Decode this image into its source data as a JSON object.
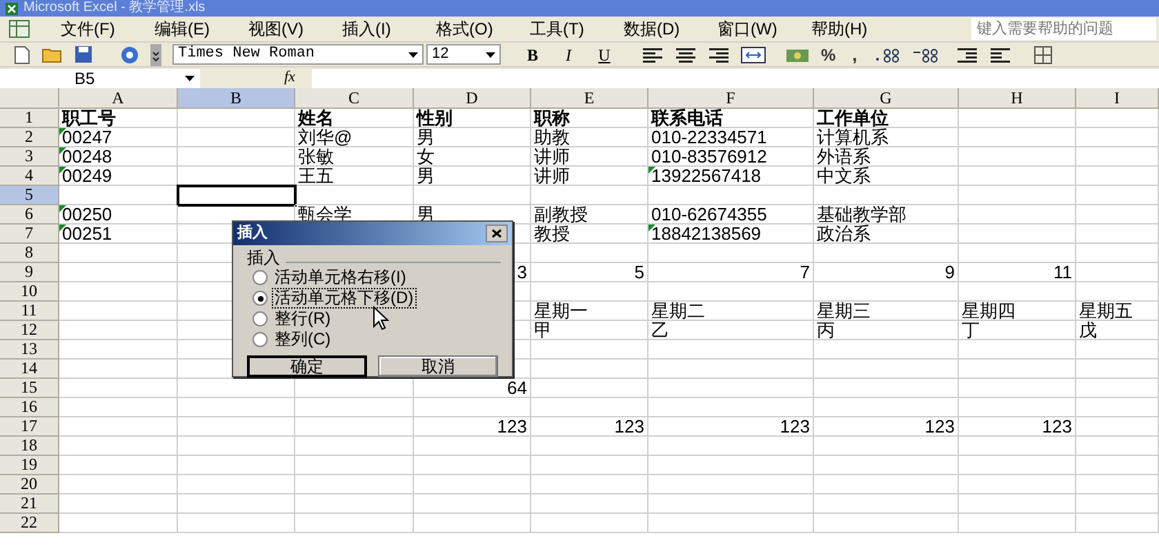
{
  "window": {
    "title": "Microsoft Excel - 教学管理.xls"
  },
  "menu": [
    "文件(F)",
    "编辑(E)",
    "视图(V)",
    "插入(I)",
    "格式(O)",
    "工具(T)",
    "数据(D)",
    "窗口(W)",
    "帮助(H)"
  ],
  "help_box": {
    "placeholder": "键入需要帮助的问题"
  },
  "toolbar": {
    "font": "Times New Roman",
    "size": "12",
    "bold": "B",
    "italic": "I",
    "underline": "U",
    "percent": "%",
    "comma": ","
  },
  "formula_bar": {
    "name_box": "B5",
    "fx": "fx"
  },
  "columns": [
    {
      "label": "A",
      "selected": false
    },
    {
      "label": "B",
      "selected": true
    },
    {
      "label": "C",
      "selected": false
    },
    {
      "label": "D",
      "selected": false
    },
    {
      "label": "E",
      "selected": false
    },
    {
      "label": "F",
      "selected": false
    },
    {
      "label": "G",
      "selected": false
    },
    {
      "label": "H",
      "selected": false
    },
    {
      "label": "I",
      "selected": false
    }
  ],
  "rows": [
    {
      "label": "1",
      "selected": false,
      "cells": [
        {
          "text": "职工号",
          "kind": "heading",
          "flag": false
        },
        null,
        {
          "text": "姓名",
          "kind": "heading",
          "flag": false
        },
        {
          "text": "性别",
          "kind": "heading",
          "flag": false
        },
        {
          "text": "职称",
          "kind": "heading",
          "flag": false
        },
        {
          "text": "联系电话",
          "kind": "heading",
          "flag": false
        },
        {
          "text": "工作单位",
          "kind": "heading",
          "flag": false
        },
        null,
        null
      ]
    },
    {
      "label": "2",
      "selected": false,
      "cells": [
        {
          "text": "00247",
          "kind": "text",
          "flag": true
        },
        null,
        {
          "text": "刘华@",
          "kind": "text",
          "flag": false
        },
        {
          "text": "男",
          "kind": "text",
          "flag": false
        },
        {
          "text": "助教",
          "kind": "text",
          "flag": false
        },
        {
          "text": "010-22334571",
          "kind": "text",
          "flag": false
        },
        {
          "text": "计算机系",
          "kind": "text",
          "flag": false
        },
        null,
        null
      ]
    },
    {
      "label": "3",
      "selected": false,
      "cells": [
        {
          "text": "00248",
          "kind": "text",
          "flag": true
        },
        null,
        {
          "text": "张敏",
          "kind": "text",
          "flag": false
        },
        {
          "text": "女",
          "kind": "text",
          "flag": false
        },
        {
          "text": "讲师",
          "kind": "text",
          "flag": false
        },
        {
          "text": "010-83576912",
          "kind": "text",
          "flag": false
        },
        {
          "text": "外语系",
          "kind": "text",
          "flag": false
        },
        null,
        null
      ]
    },
    {
      "label": "4",
      "selected": false,
      "cells": [
        {
          "text": "00249",
          "kind": "text",
          "flag": true
        },
        null,
        {
          "text": "王五",
          "kind": "text",
          "flag": false
        },
        {
          "text": "男",
          "kind": "text",
          "flag": false
        },
        {
          "text": "讲师",
          "kind": "text",
          "flag": false
        },
        {
          "text": "13922567418",
          "kind": "text",
          "flag": true
        },
        {
          "text": "中文系",
          "kind": "text",
          "flag": false
        },
        null,
        null
      ]
    },
    {
      "label": "5",
      "selected": true,
      "cells": [
        null,
        null,
        null,
        null,
        null,
        null,
        null,
        null,
        null
      ]
    },
    {
      "label": "6",
      "selected": false,
      "cells": [
        {
          "text": "00250",
          "kind": "text",
          "flag": true
        },
        null,
        {
          "text": "甄会学",
          "kind": "text",
          "flag": false
        },
        {
          "text": "男",
          "kind": "text",
          "flag": false
        },
        {
          "text": "副教授",
          "kind": "text",
          "flag": false
        },
        {
          "text": "010-62674355",
          "kind": "text",
          "flag": false
        },
        {
          "text": "基础教学部",
          "kind": "text",
          "flag": false
        },
        null,
        null
      ]
    },
    {
      "label": "7",
      "selected": false,
      "cells": [
        {
          "text": "00251",
          "kind": "text",
          "flag": true
        },
        null,
        null,
        null,
        {
          "text": "教授",
          "kind": "text",
          "flag": false
        },
        {
          "text": "18842138569",
          "kind": "text",
          "flag": true
        },
        {
          "text": "政治系",
          "kind": "text",
          "flag": false
        },
        null,
        null
      ]
    },
    {
      "label": "8",
      "selected": false,
      "cells": [
        null,
        null,
        null,
        null,
        null,
        null,
        null,
        null,
        null
      ]
    },
    {
      "label": "9",
      "selected": false,
      "cells": [
        null,
        null,
        null,
        {
          "text": "3",
          "kind": "number",
          "flag": false
        },
        {
          "text": "5",
          "kind": "number",
          "flag": false
        },
        {
          "text": "7",
          "kind": "number",
          "flag": false
        },
        {
          "text": "9",
          "kind": "number",
          "flag": false
        },
        {
          "text": "11",
          "kind": "number",
          "flag": false
        },
        null
      ]
    },
    {
      "label": "10",
      "selected": false,
      "cells": [
        null,
        null,
        null,
        null,
        null,
        null,
        null,
        null,
        null
      ]
    },
    {
      "label": "11",
      "selected": false,
      "cells": [
        null,
        null,
        null,
        null,
        {
          "text": "星期一",
          "kind": "text",
          "flag": false
        },
        {
          "text": "星期二",
          "kind": "text",
          "flag": false
        },
        {
          "text": "星期三",
          "kind": "text",
          "flag": false
        },
        {
          "text": "星期四",
          "kind": "text",
          "flag": false
        },
        {
          "text": "星期五",
          "kind": "text",
          "flag": false
        }
      ]
    },
    {
      "label": "12",
      "selected": false,
      "cells": [
        null,
        null,
        null,
        null,
        {
          "text": "甲",
          "kind": "text",
          "flag": false
        },
        {
          "text": "乙",
          "kind": "text",
          "flag": false
        },
        {
          "text": "丙",
          "kind": "text",
          "flag": false
        },
        {
          "text": "丁",
          "kind": "text",
          "flag": false
        },
        {
          "text": "戊",
          "kind": "text",
          "flag": false
        }
      ]
    },
    {
      "label": "13",
      "selected": false,
      "cells": [
        null,
        null,
        null,
        null,
        null,
        null,
        null,
        null,
        null
      ]
    },
    {
      "label": "14",
      "selected": false,
      "cells": [
        null,
        null,
        null,
        null,
        null,
        null,
        null,
        null,
        null
      ]
    },
    {
      "label": "15",
      "selected": false,
      "cells": [
        null,
        null,
        null,
        {
          "text": "64",
          "kind": "number",
          "flag": false
        },
        null,
        null,
        null,
        null,
        null
      ]
    },
    {
      "label": "16",
      "selected": false,
      "cells": [
        null,
        null,
        null,
        null,
        null,
        null,
        null,
        null,
        null
      ]
    },
    {
      "label": "17",
      "selected": false,
      "cells": [
        null,
        null,
        null,
        {
          "text": "123",
          "kind": "number",
          "flag": false
        },
        {
          "text": "123",
          "kind": "number",
          "flag": false
        },
        {
          "text": "123",
          "kind": "number",
          "flag": false
        },
        {
          "text": "123",
          "kind": "number",
          "flag": false
        },
        {
          "text": "123",
          "kind": "number",
          "flag": false
        },
        null
      ]
    },
    {
      "label": "18",
      "selected": false,
      "cells": [
        null,
        null,
        null,
        null,
        null,
        null,
        null,
        null,
        null
      ]
    },
    {
      "label": "19",
      "selected": false,
      "cells": [
        null,
        null,
        null,
        null,
        null,
        null,
        null,
        null,
        null
      ]
    },
    {
      "label": "20",
      "selected": false,
      "cells": [
        null,
        null,
        null,
        null,
        null,
        null,
        null,
        null,
        null
      ]
    },
    {
      "label": "21",
      "selected": false,
      "cells": [
        null,
        null,
        null,
        null,
        null,
        null,
        null,
        null,
        null
      ]
    },
    {
      "label": "22",
      "selected": false,
      "cells": [
        null,
        null,
        null,
        null,
        null,
        null,
        null,
        null,
        null
      ]
    }
  ],
  "dialog": {
    "title": "插入",
    "group": "插入",
    "options": [
      {
        "label": "活动单元格右移(I)",
        "selected": false
      },
      {
        "label": "活动单元格下移(D)",
        "selected": true
      },
      {
        "label": "整行(R)",
        "selected": false
      },
      {
        "label": "整列(C)",
        "selected": false
      }
    ],
    "buttons": [
      "确定",
      "取消"
    ]
  }
}
